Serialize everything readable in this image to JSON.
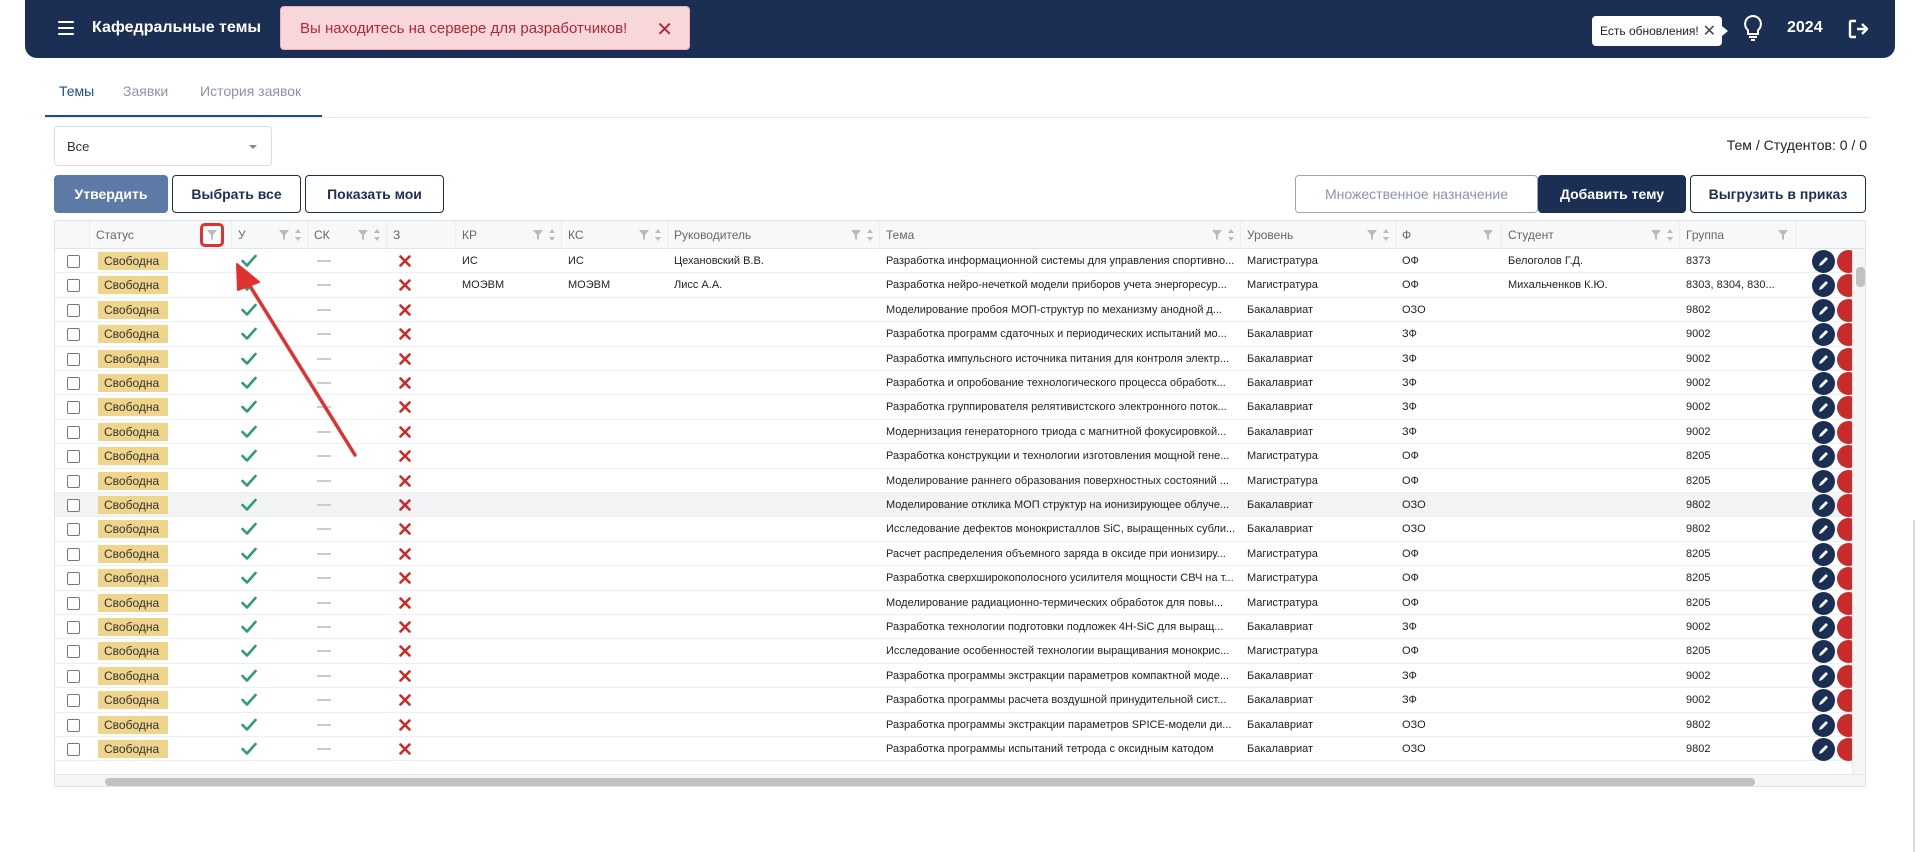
{
  "header": {
    "title": "Кафедральные темы",
    "dev_alert": "Вы находитесь на сервере для разработчиков!",
    "updates_tip": "Есть обновления!",
    "year": "2024"
  },
  "tabs": [
    {
      "label": "Темы",
      "active": true
    },
    {
      "label": "Заявки",
      "active": false
    },
    {
      "label": "История заявок",
      "active": false
    }
  ],
  "filter": {
    "status_value": "Все"
  },
  "counter": "Тем / Студентов: 0 / 0",
  "buttons": {
    "approve": "Утвердить",
    "select_all": "Выбрать все",
    "show_mine": "Показать мои",
    "multi_assign": "Множественное назначение",
    "add_topic": "Добавить тему",
    "export": "Выгрузить в приказ"
  },
  "table": {
    "columns": [
      "Статус",
      "У",
      "СК",
      "З",
      "КР",
      "КС",
      "Руководитель",
      "Тема",
      "Уровень",
      "Ф",
      "Студент",
      "Группа"
    ],
    "rows": [
      {
        "status": "Свободна",
        "kr": "ИС",
        "ks": "ИС",
        "supervisor": "Цехановский В.В.",
        "topic": "Разработка информационной системы для управления спортивно...",
        "level": "Магистратура",
        "form": "ОФ",
        "student": "Белоголов Г.Д.",
        "group": "8373"
      },
      {
        "status": "Свободна",
        "kr": "МОЭВМ",
        "ks": "МОЭВМ",
        "supervisor": "Лисс А.А.",
        "topic": "Разработка нейро-нечеткой модели приборов учета энергоресур...",
        "level": "Магистратура",
        "form": "ОФ",
        "student": "Михальченков К.Ю.",
        "group": "8303, 8304, 830..."
      },
      {
        "status": "Свободна",
        "kr": "",
        "ks": "",
        "supervisor": "",
        "topic": "Моделирование пробоя МОП-структур по механизму анодной д...",
        "level": "Бакалавриат",
        "form": "ОЗО",
        "student": "",
        "group": "9802"
      },
      {
        "status": "Свободна",
        "kr": "",
        "ks": "",
        "supervisor": "",
        "topic": "Разработка программ сдаточных и периодических испытаний мо...",
        "level": "Бакалавриат",
        "form": "ЗФ",
        "student": "",
        "group": "9002"
      },
      {
        "status": "Свободна",
        "kr": "",
        "ks": "",
        "supervisor": "",
        "topic": "Разработка импульсного источника питания для контроля электр...",
        "level": "Бакалавриат",
        "form": "ЗФ",
        "student": "",
        "group": "9002"
      },
      {
        "status": "Свободна",
        "kr": "",
        "ks": "",
        "supervisor": "",
        "topic": "Разработка и опробование технологического процесса обработк...",
        "level": "Бакалавриат",
        "form": "ЗФ",
        "student": "",
        "group": "9002"
      },
      {
        "status": "Свободна",
        "kr": "",
        "ks": "",
        "supervisor": "",
        "topic": "Разработка группирователя релятивистского электронного поток...",
        "level": "Бакалавриат",
        "form": "ЗФ",
        "student": "",
        "group": "9002"
      },
      {
        "status": "Свободна",
        "kr": "",
        "ks": "",
        "supervisor": "",
        "topic": "Модернизация генераторного триода с магнитной фокусировкой...",
        "level": "Бакалавриат",
        "form": "ЗФ",
        "student": "",
        "group": "9002"
      },
      {
        "status": "Свободна",
        "kr": "",
        "ks": "",
        "supervisor": "",
        "topic": "Разработка конструкции и технологии изготовления мощной гене...",
        "level": "Магистратура",
        "form": "ОФ",
        "student": "",
        "group": "8205"
      },
      {
        "status": "Свободна",
        "kr": "",
        "ks": "",
        "supervisor": "",
        "topic": "Моделирование раннего образования поверхностных состояний ...",
        "level": "Магистратура",
        "form": "ОФ",
        "student": "",
        "group": "8205"
      },
      {
        "status": "Свободна",
        "kr": "",
        "ks": "",
        "supervisor": "",
        "topic": "Моделирование отклика МОП структур на ионизирующее облуче...",
        "level": "Бакалавриат",
        "form": "ОЗО",
        "student": "",
        "group": "9802"
      },
      {
        "status": "Свободна",
        "kr": "",
        "ks": "",
        "supervisor": "",
        "topic": "Исследование дефектов монокристаллов SiC, выращенных субли...",
        "level": "Бакалавриат",
        "form": "ОЗО",
        "student": "",
        "group": "9802"
      },
      {
        "status": "Свободна",
        "kr": "",
        "ks": "",
        "supervisor": "",
        "topic": "Расчет распределения объемного заряда в оксиде при ионизиру...",
        "level": "Магистратура",
        "form": "ОФ",
        "student": "",
        "group": "8205"
      },
      {
        "status": "Свободна",
        "kr": "",
        "ks": "",
        "supervisor": "",
        "topic": "Разработка сверхширокополосного усилителя мощности СВЧ на т...",
        "level": "Магистратура",
        "form": "ОФ",
        "student": "",
        "group": "8205"
      },
      {
        "status": "Свободна",
        "kr": "",
        "ks": "",
        "supervisor": "",
        "topic": "Моделирование радиационно-термических обработок для повы...",
        "level": "Магистратура",
        "form": "ОФ",
        "student": "",
        "group": "8205"
      },
      {
        "status": "Свободна",
        "kr": "",
        "ks": "",
        "supervisor": "",
        "topic": "Разработка технологии подготовки подложек 4H-SiC для выращ...",
        "level": "Бакалавриат",
        "form": "ЗФ",
        "student": "",
        "group": "9002"
      },
      {
        "status": "Свободна",
        "kr": "",
        "ks": "",
        "supervisor": "",
        "topic": "Исследование особенностей технологии выращивания монокрис...",
        "level": "Магистратура",
        "form": "ОФ",
        "student": "",
        "group": "8205"
      },
      {
        "status": "Свободна",
        "kr": "",
        "ks": "",
        "supervisor": "",
        "topic": "Разработка программы экстракции параметров компактной моде...",
        "level": "Бакалавриат",
        "form": "ЗФ",
        "student": "",
        "group": "9002"
      },
      {
        "status": "Свободна",
        "kr": "",
        "ks": "",
        "supervisor": "",
        "topic": "Разработка программы расчета воздушной принудительной сист...",
        "level": "Бакалавриат",
        "form": "ЗФ",
        "student": "",
        "group": "9002"
      },
      {
        "status": "Свободна",
        "kr": "",
        "ks": "",
        "supervisor": "",
        "topic": "Разработка программы экстракции параметров SPICE-модели ди...",
        "level": "Бакалавриат",
        "form": "ОЗО",
        "student": "",
        "group": "9802"
      },
      {
        "status": "Свободна",
        "kr": "",
        "ks": "",
        "supervisor": "",
        "topic": "Разработка программы испытаний тетрода с оксидным катодом",
        "level": "Бакалавриат",
        "form": "ОЗО",
        "student": "",
        "group": "9802"
      }
    ]
  },
  "colors": {
    "navbar": "#1b2f55",
    "badge": "#efd58c",
    "check": "#2f9e6e",
    "cross": "#c92a2a",
    "highlight": "#e03131"
  }
}
